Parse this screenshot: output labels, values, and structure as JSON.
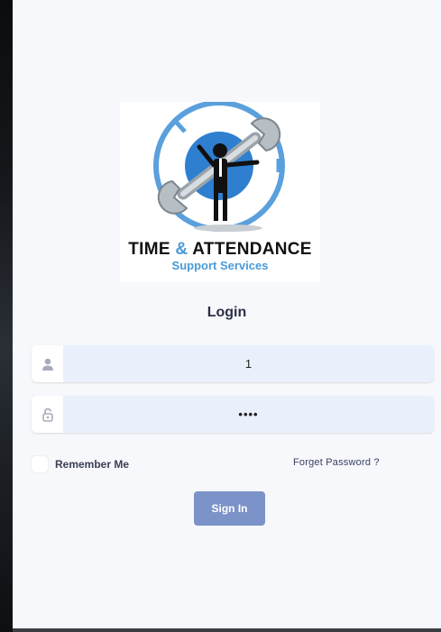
{
  "logo": {
    "title_part1": "TIME ",
    "title_amp": "&",
    "title_part2": " ATTENDANCE",
    "subtitle": "Support Services",
    "colors": {
      "ring": "#5aa0dc",
      "accent": "#4a9ad8",
      "figure": "#111111"
    }
  },
  "login": {
    "title": "Login",
    "username": {
      "icon": "user-icon",
      "value": "1"
    },
    "password": {
      "icon": "lock-icon",
      "value": "••••"
    },
    "remember_label": "Remember Me",
    "forget_label": "Forget Password ?",
    "signin_label": "Sign In"
  },
  "colors": {
    "panel_bg": "#f6f8fc",
    "field_bg": "#e9effb",
    "button_bg": "#7b93c8",
    "text_dark": "#2b2f45"
  }
}
